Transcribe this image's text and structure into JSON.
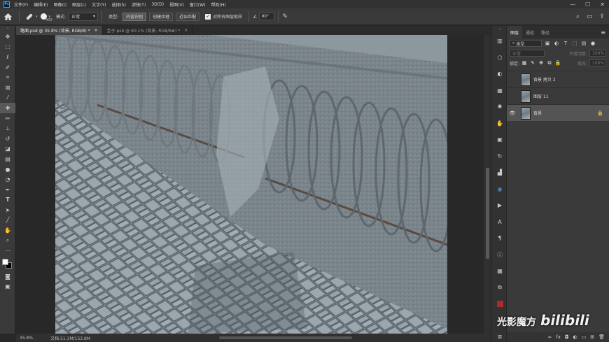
{
  "app": {
    "logo": "Ps"
  },
  "menu": [
    "文件(F)",
    "编辑(E)",
    "图像(I)",
    "图层(L)",
    "文字(Y)",
    "选择(S)",
    "滤镜(T)",
    "3D(D)",
    "视图(V)",
    "窗口(W)",
    "帮助(H)"
  ],
  "window_controls": [
    "—",
    "☐",
    "✕"
  ],
  "options": {
    "brush_size": "400",
    "mode_label": "模式:",
    "mode_value": "正常",
    "type_label": "类型:",
    "type_buttons": [
      "内容识别",
      "创建纹理",
      "近似匹配"
    ],
    "active_type": "内容识别",
    "sample_all_label": "对所有图层取样",
    "angle_value": "90°"
  },
  "tabs": [
    {
      "label": "路面.psd @ 35.8% (背景, RGB/8) *",
      "active": true
    },
    {
      "label": "金子.psb @ 60.1% (背景, RGB/8#) *",
      "active": false
    }
  ],
  "status": {
    "zoom": "35.8%",
    "doc_size": "文档:51.3M/153.8M"
  },
  "layers_panel": {
    "tabs": [
      "图层",
      "通道",
      "路径"
    ],
    "active_tab": "图层",
    "filter_label": "类型",
    "blend_mode": "正常",
    "opacity_label": "不透明度:",
    "opacity_value": "100%",
    "lock_label": "锁定:",
    "fill_label": "填充:",
    "fill_value": "100%",
    "layers": [
      {
        "name": "背景 拷贝 2",
        "visible": false,
        "selected": false,
        "locked": false
      },
      {
        "name": "图层 11",
        "visible": false,
        "selected": false,
        "locked": false
      },
      {
        "name": "背景",
        "visible": true,
        "selected": true,
        "locked": true
      }
    ]
  },
  "watermark": {
    "text": "光影魔方",
    "brand": "bilibili"
  }
}
